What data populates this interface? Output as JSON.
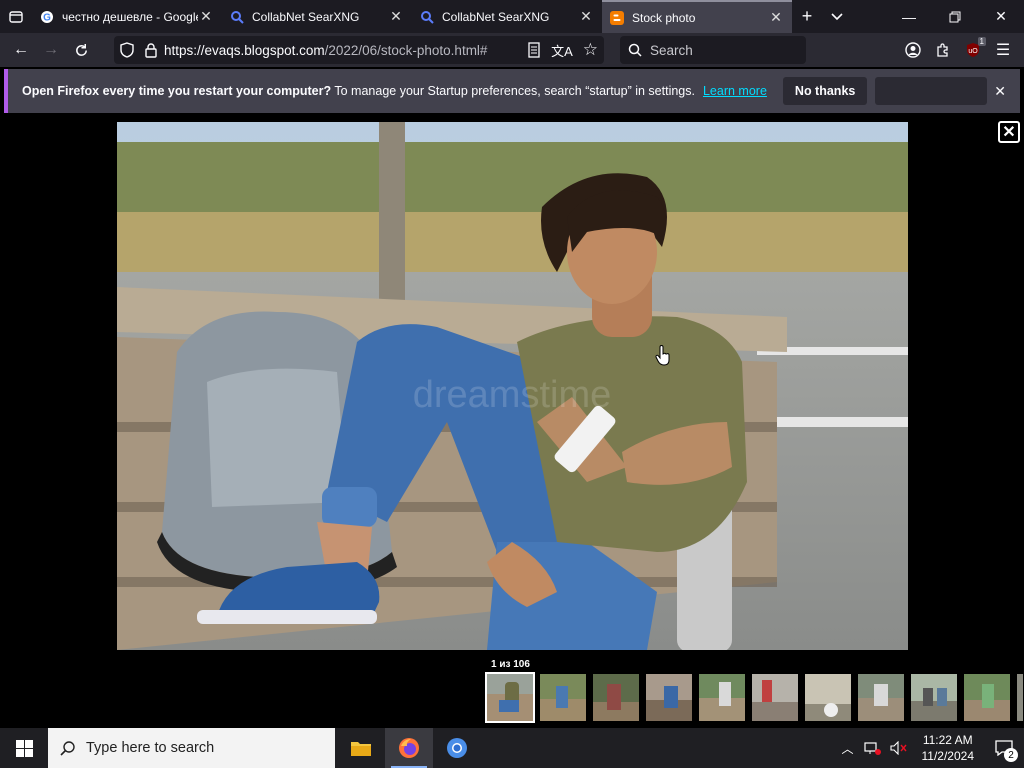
{
  "browser": {
    "tabs": [
      {
        "title": "честно дешевле - Google",
        "favicon": "google-icon",
        "active": false
      },
      {
        "title": "CollabNet SearXNG",
        "favicon": "searxng-icon",
        "active": false
      },
      {
        "title": "CollabNet SearXNG",
        "favicon": "searxng-icon",
        "active": false
      },
      {
        "title": "Stock photo",
        "favicon": "blogger-icon",
        "active": true
      }
    ],
    "url_host": "https://evaqs.blogspot.com",
    "url_path": "/2022/06/stock-photo.html#",
    "search_placeholder": "Search",
    "extension_badge": "1"
  },
  "notification": {
    "bold": "Open Firefox every time you restart your computer?",
    "text": "To manage your Startup preferences, search “startup” in settings.",
    "link": "Learn more",
    "button": "No thanks"
  },
  "viewer": {
    "counter": "1 из 106",
    "thumb_count": 11,
    "selected_index": 0
  },
  "taskbar": {
    "search_placeholder": "Type here to search",
    "time": "11:22 AM",
    "date": "11/2/2024",
    "notification_count": "2"
  },
  "colors": {
    "accent": "#b15cea",
    "link": "#00ddff",
    "tab_active": "#42414d"
  }
}
